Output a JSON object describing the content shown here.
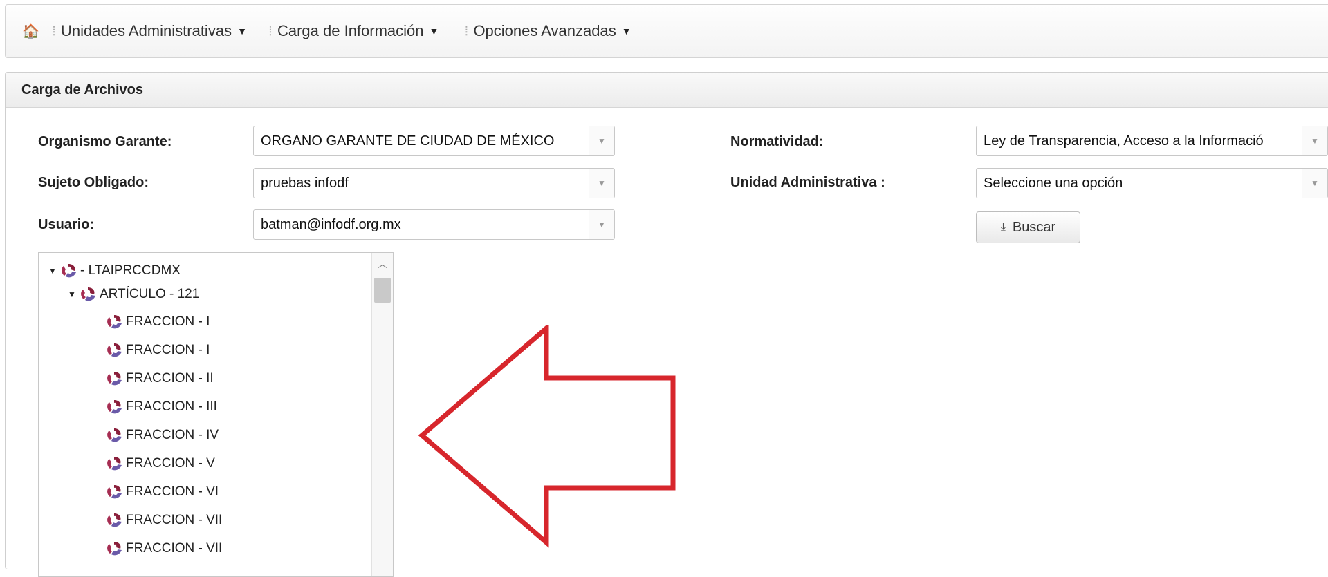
{
  "nav": {
    "home_icon": "home-icon",
    "items": [
      {
        "label": "Unidades Administrativas"
      },
      {
        "label": "Carga de Información"
      },
      {
        "label": "Opciones Avanzadas"
      }
    ]
  },
  "panel": {
    "title": "Carga de Archivos",
    "fields": {
      "organismo_label": "Organismo Garante:",
      "organismo_value": "ORGANO GARANTE DE CIUDAD DE MÉXICO",
      "sujeto_label": "Sujeto Obligado:",
      "sujeto_value": "pruebas infodf",
      "usuario_label": "Usuario:",
      "usuario_value": "batman@infodf.org.mx",
      "normatividad_label": "Normatividad:",
      "normatividad_value": "Ley de Transparencia, Acceso a la Informació",
      "unidad_label": "Unidad Administrativa :",
      "unidad_value": "Seleccione una opción"
    },
    "search_button": "Buscar"
  },
  "tree": {
    "root": "- LTAIPRCCDMX",
    "child": "ARTÍCULO - 121",
    "leaves": [
      "FRACCION - I",
      "FRACCION - I",
      "FRACCION - II",
      "FRACCION - III",
      "FRACCION - IV",
      "FRACCION - V",
      "FRACCION - VI",
      "FRACCION - VII",
      "FRACCION - VII"
    ]
  },
  "colors": {
    "annotation_arrow": "#d7262c",
    "logo_accent": "#8a1f3b",
    "logo_accent2": "#6a5aa8"
  }
}
